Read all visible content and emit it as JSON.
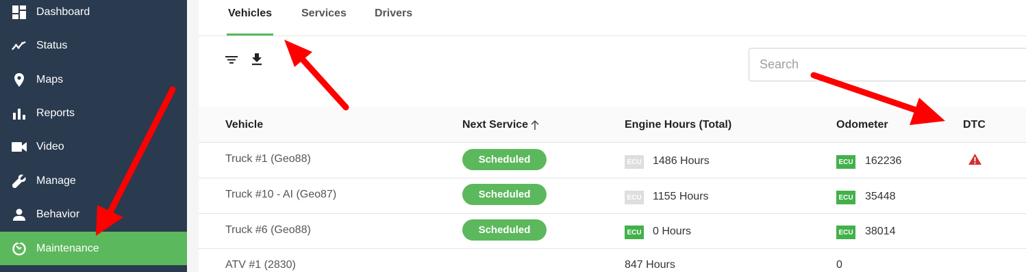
{
  "sidebar": {
    "items": [
      {
        "label": "Dashboard",
        "icon": "dashboard-icon"
      },
      {
        "label": "Status",
        "icon": "trend-icon"
      },
      {
        "label": "Maps",
        "icon": "map-pin-icon"
      },
      {
        "label": "Reports",
        "icon": "bar-chart-icon"
      },
      {
        "label": "Video",
        "icon": "video-camera-icon"
      },
      {
        "label": "Manage",
        "icon": "wrench-icon"
      },
      {
        "label": "Behavior",
        "icon": "person-icon"
      },
      {
        "label": "Maintenance",
        "icon": "maintenance-icon",
        "active": true
      }
    ]
  },
  "tabs": [
    {
      "label": "Vehicles",
      "active": true
    },
    {
      "label": "Services"
    },
    {
      "label": "Drivers"
    }
  ],
  "toolbar": {
    "filter_icon": "filter-icon",
    "download_icon": "download-icon"
  },
  "search": {
    "placeholder": "Search"
  },
  "table": {
    "headers": {
      "vehicle": "Vehicle",
      "next_service": "Next Service",
      "engine_hours": "Engine Hours (Total)",
      "odometer": "Odometer",
      "dtc": "DTC"
    },
    "rows": [
      {
        "vehicle": "Truck #1 (Geo88)",
        "status": "Scheduled",
        "engine_ecu": "ECU",
        "engine_hours": "1486 Hours",
        "odo_ecu": "ECU",
        "odometer": "162236",
        "dtc": "warning-icon"
      },
      {
        "vehicle": "Truck #10 - AI (Geo87)",
        "status": "Scheduled",
        "engine_ecu": "ECU",
        "engine_hours": "1155 Hours",
        "odo_ecu": "ECU",
        "odometer": "35448"
      },
      {
        "vehicle": "Truck #6 (Geo88)",
        "status": "Scheduled",
        "engine_ecu": "ECU",
        "engine_hours": "0 Hours",
        "odo_ecu": "ECU",
        "odometer": "38014"
      },
      {
        "vehicle": "ATV #1 (2830)",
        "engine_hours": "847 Hours",
        "odometer": "0"
      }
    ]
  },
  "colors": {
    "sidebar_bg": "#2a3a4f",
    "accent_green": "#5cb85c",
    "ecu_grey": "#dedede",
    "ecu_green": "#43b14b",
    "warning_red": "#d32f2f",
    "annotation_arrow": "#ff0000"
  }
}
